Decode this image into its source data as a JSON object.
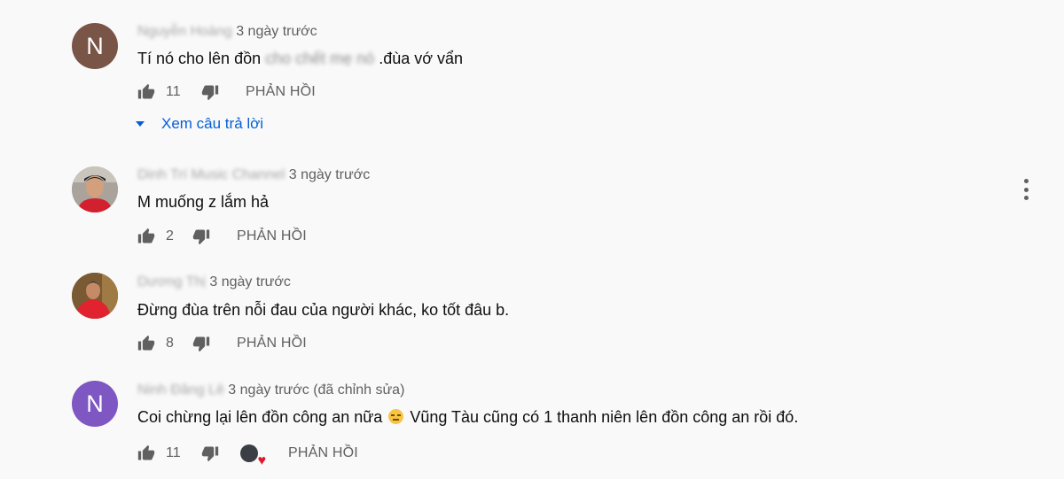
{
  "comments": [
    {
      "author": "Nguyễn Hoàng",
      "avatar_letter": "N",
      "avatar_color": "#795548",
      "time": "3 ngày trước",
      "text_before": "Tí  nó  cho lên đồn",
      "text_hidden": " cho chết mẹ nó ",
      "text_after": ".đùa  vớ  vẩn",
      "likes": "11",
      "reply_label": "PHẢN HỒI",
      "view_replies": "Xem câu trả lời"
    },
    {
      "author": "Dinh Trí Music Channel",
      "time": "3 ngày trước",
      "text": "M muống z lắm hả",
      "likes": "2",
      "reply_label": "PHẢN HỒI"
    },
    {
      "author": "Dương Thị",
      "time": "3 ngày trước",
      "text": "Đừng đùa trên nỗi đau của người khác, ko tốt đâu b.",
      "likes": "8",
      "reply_label": "PHẢN HỒI"
    },
    {
      "author": "Ninh Đăng Lê",
      "avatar_letter": "N",
      "avatar_color": "#7e57c2",
      "time": "3 ngày trước (đã chỉnh sửa)",
      "text_before": "Coi chừng lại lên đồn công an nữa",
      "text_after": "  Vũng Tàu cũng có 1 thanh niên lên đồn công an rồi đó.",
      "likes": "11",
      "reply_label": "PHẢN HỒI"
    }
  ],
  "icons": {
    "like": "thumb-up-icon",
    "dislike": "thumb-down-icon",
    "more": "more-vert-icon",
    "expand": "caret-down-icon",
    "emoji": "expressionless-face-emoji",
    "creator_heart": "creator-heart-icon"
  }
}
